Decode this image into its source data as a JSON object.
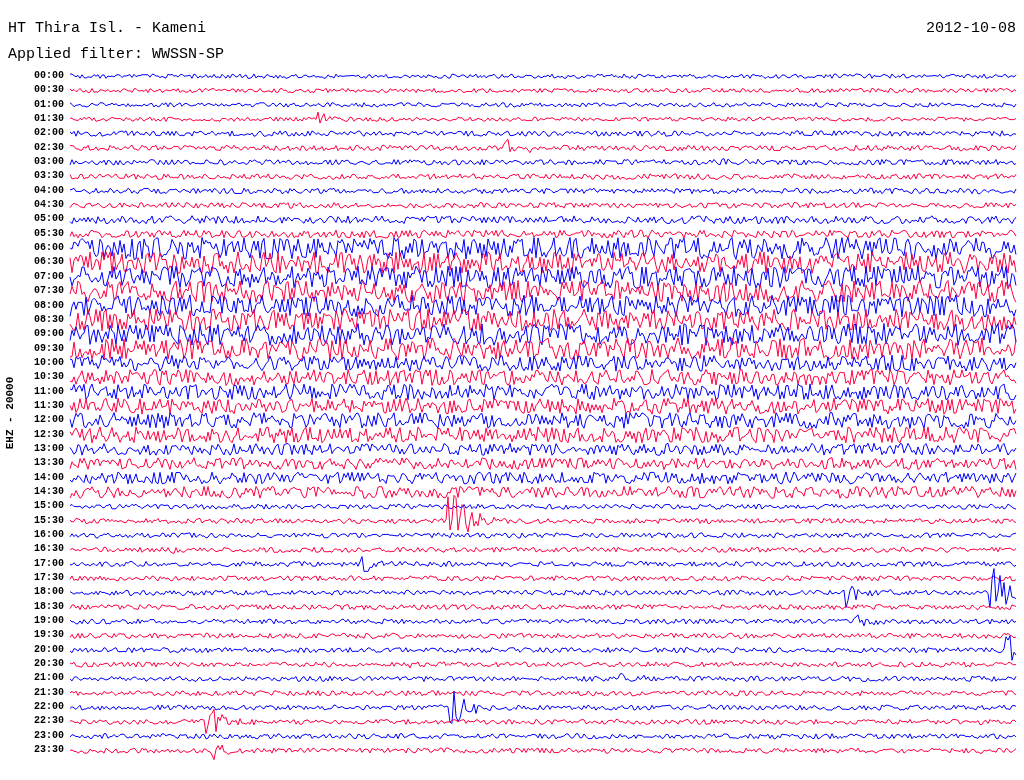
{
  "header": {
    "station": "HT Thira Isl. - Kameni",
    "date": "2012-10-08",
    "filter": "Applied filter: WWSSN-SP"
  },
  "channel": "EHZ - 20000",
  "rows": [
    {
      "time": "00:00",
      "color": "#0000ff"
    },
    {
      "time": "00:30",
      "color": "#ff0040"
    },
    {
      "time": "01:00",
      "color": "#0000ff"
    },
    {
      "time": "01:30",
      "color": "#ff0040"
    },
    {
      "time": "02:00",
      "color": "#0000ff"
    },
    {
      "time": "02:30",
      "color": "#ff0040"
    },
    {
      "time": "03:00",
      "color": "#0000ff"
    },
    {
      "time": "03:30",
      "color": "#ff0040"
    },
    {
      "time": "04:00",
      "color": "#0000ff"
    },
    {
      "time": "04:30",
      "color": "#ff0040"
    },
    {
      "time": "05:00",
      "color": "#0000ff"
    },
    {
      "time": "05:30",
      "color": "#ff0040"
    },
    {
      "time": "06:00",
      "color": "#0000ff"
    },
    {
      "time": "06:30",
      "color": "#ff0040"
    },
    {
      "time": "07:00",
      "color": "#0000ff"
    },
    {
      "time": "07:30",
      "color": "#ff0040"
    },
    {
      "time": "08:00",
      "color": "#0000ff"
    },
    {
      "time": "08:30",
      "color": "#ff0040"
    },
    {
      "time": "09:00",
      "color": "#0000ff"
    },
    {
      "time": "09:30",
      "color": "#ff0040"
    },
    {
      "time": "10:00",
      "color": "#0000ff"
    },
    {
      "time": "10:30",
      "color": "#ff0040"
    },
    {
      "time": "11:00",
      "color": "#0000ff"
    },
    {
      "time": "11:30",
      "color": "#ff0040"
    },
    {
      "time": "12:00",
      "color": "#0000ff"
    },
    {
      "time": "12:30",
      "color": "#ff0040"
    },
    {
      "time": "13:00",
      "color": "#0000ff"
    },
    {
      "time": "13:30",
      "color": "#ff0040"
    },
    {
      "time": "14:00",
      "color": "#0000ff"
    },
    {
      "time": "14:30",
      "color": "#ff0040"
    },
    {
      "time": "15:00",
      "color": "#0000ff"
    },
    {
      "time": "15:30",
      "color": "#ff0040"
    },
    {
      "time": "16:00",
      "color": "#0000ff"
    },
    {
      "time": "16:30",
      "color": "#ff0040"
    },
    {
      "time": "17:00",
      "color": "#0000ff"
    },
    {
      "time": "17:30",
      "color": "#ff0040"
    },
    {
      "time": "18:00",
      "color": "#0000ff"
    },
    {
      "time": "18:30",
      "color": "#ff0040"
    },
    {
      "time": "19:00",
      "color": "#0000ff"
    },
    {
      "time": "19:30",
      "color": "#ff0040"
    },
    {
      "time": "20:00",
      "color": "#0000ff"
    },
    {
      "time": "20:30",
      "color": "#ff0040"
    },
    {
      "time": "21:00",
      "color": "#0000ff"
    },
    {
      "time": "21:30",
      "color": "#ff0040"
    },
    {
      "time": "22:00",
      "color": "#0000ff"
    },
    {
      "time": "22:30",
      "color": "#ff0040"
    },
    {
      "time": "23:00",
      "color": "#0000ff"
    },
    {
      "time": "23:30",
      "color": "#ff0040"
    }
  ]
}
